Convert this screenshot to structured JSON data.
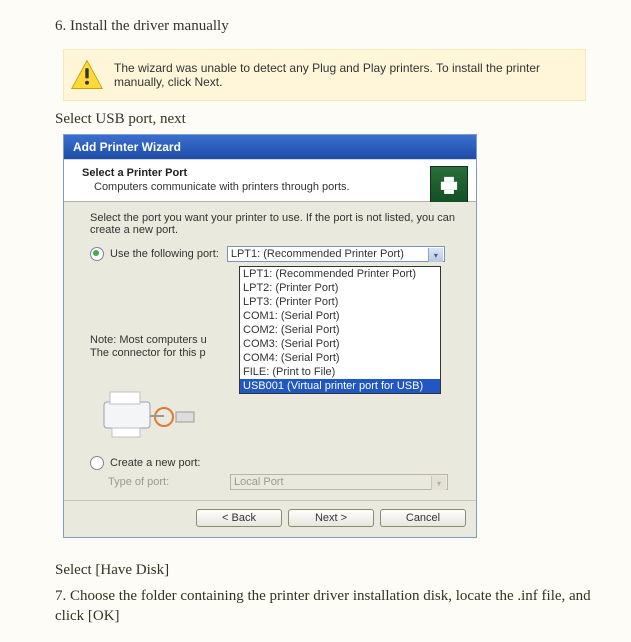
{
  "step6": {
    "heading": "6. Install the driver manually",
    "warning": "The wizard was unable to detect any Plug and Play printers. To install the printer manually, click Next.",
    "caption": "Select USB port, next"
  },
  "wizard": {
    "titlebar": "Add Printer Wizard",
    "header_title": "Select a Printer Port",
    "header_sub": "Computers communicate with printers through ports.",
    "instruction": "Select the port you want your printer to use.  If the port is not listed, you can create a new port.",
    "use_port_label": "Use the following port:",
    "selected_port": "LPT1: (Recommended Printer Port)",
    "port_options": [
      "LPT1: (Recommended Printer Port)",
      "LPT2: (Printer Port)",
      "LPT3: (Printer Port)",
      "COM1: (Serial Port)",
      "COM2: (Serial Port)",
      "COM3: (Serial Port)",
      "COM4: (Serial Port)",
      "FILE: (Print to File)",
      "USB001 (Virtual printer port for USB)"
    ],
    "note_line1": "Note: Most computers u",
    "note_line2": "The connector for this p",
    "create_port_label": "Create a new port:",
    "type_of_port_label": "Type of port:",
    "type_of_port_value": "Local Port",
    "btn_back": "< Back",
    "btn_next": "Next >",
    "btn_cancel": "Cancel"
  },
  "after": {
    "line1": "Select [Have Disk]",
    "line2": "7. Choose the folder containing the printer driver installation disk, locate the .inf file, and click [OK]"
  }
}
